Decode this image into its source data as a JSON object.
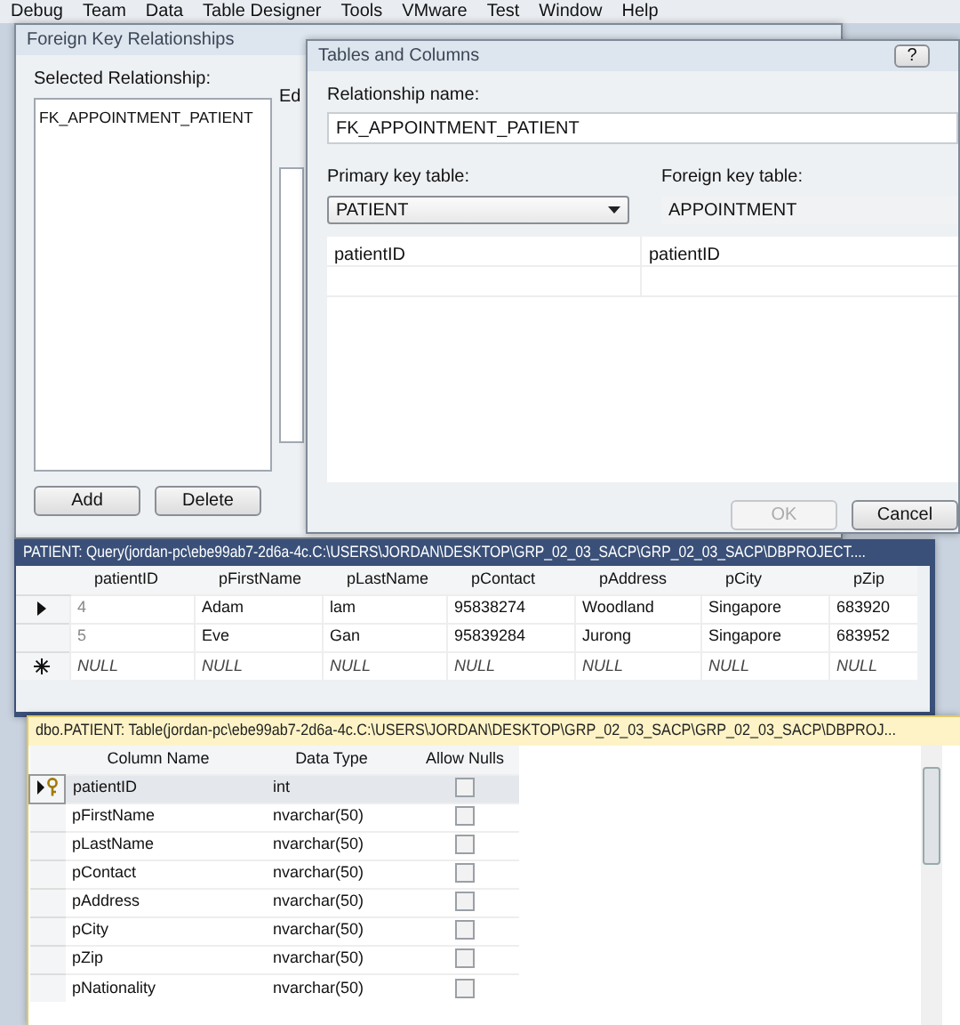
{
  "menu": [
    "Debug",
    "Team",
    "Data",
    "Table Designer",
    "Tools",
    "VMware",
    "Test",
    "Window",
    "Help"
  ],
  "fk_dialog": {
    "title": "Foreign Key Relationships",
    "list_label": "Selected Relationship:",
    "relationships": [
      {
        "name": "FK_APPOINTMENT_PATIENT",
        "selected": false
      }
    ],
    "partial_label": "Ed",
    "buttons": [
      "Add",
      "Delete"
    ]
  },
  "tc_dialog": {
    "title": "Tables and Columns",
    "help": "?",
    "name_label": "Relationship name:",
    "name_value": "FK_APPOINTMENT_PATIENT",
    "pk_label": "Primary key table:",
    "pk_value": "PATIENT",
    "fk_label": "Foreign key table:",
    "fk_value": "APPOINTMENT",
    "mappings": [
      {
        "primary": "patientID",
        "foreign": "patientID"
      }
    ],
    "buttons": [
      {
        "label": "OK",
        "disabled": true
      },
      {
        "label": "Cancel",
        "disabled": false
      }
    ]
  },
  "query": {
    "title": "PATIENT: Query(jordan-pc\\ebe99ab7-2d6a-4c.C:\\USERS\\JORDAN\\DESKTOP\\GRP_02_03_SACP\\GRP_02_03_SACP\\DBPROJECT....",
    "columns": [
      "patientID",
      "pFirstName",
      "pLastName",
      "pContact",
      "pAddress",
      "pCity",
      "pZip"
    ],
    "rows": [
      {
        "kind": "current",
        "cells": [
          "4",
          "Adam",
          "lam",
          "95838274",
          "Woodland",
          "Singapore",
          "683920"
        ]
      },
      {
        "kind": "data",
        "cells": [
          "5",
          "Eve",
          "Gan",
          "95839284",
          "Jurong",
          "Singapore",
          "683952"
        ]
      },
      {
        "kind": "new",
        "cells": [
          "NULL",
          "NULL",
          "NULL",
          "NULL",
          "NULL",
          "NULL",
          "NULL"
        ]
      }
    ]
  },
  "designer": {
    "title": "dbo.PATIENT: Table(jordan-pc\\ebe99ab7-2d6a-4c.C:\\USERS\\JORDAN\\DESKTOP\\GRP_02_03_SACP\\GRP_02_03_SACP\\DBPROJ...",
    "columns": [
      "Column Name",
      "Data Type",
      "Allow Nulls"
    ],
    "rows": [
      {
        "name": "patientID",
        "type": "int",
        "allow_nulls": false,
        "primary_key": true,
        "selected": true
      },
      {
        "name": "pFirstName",
        "type": "nvarchar(50)",
        "allow_nulls": false,
        "primary_key": false,
        "selected": false
      },
      {
        "name": "pLastName",
        "type": "nvarchar(50)",
        "allow_nulls": false,
        "primary_key": false,
        "selected": false
      },
      {
        "name": "pContact",
        "type": "nvarchar(50)",
        "allow_nulls": false,
        "primary_key": false,
        "selected": false
      },
      {
        "name": "pAddress",
        "type": "nvarchar(50)",
        "allow_nulls": false,
        "primary_key": false,
        "selected": false
      },
      {
        "name": "pCity",
        "type": "nvarchar(50)",
        "allow_nulls": false,
        "primary_key": false,
        "selected": false
      },
      {
        "name": "pZip",
        "type": "nvarchar(50)",
        "allow_nulls": false,
        "primary_key": false,
        "selected": false
      },
      {
        "name": "pNationality",
        "type": "nvarchar(50)",
        "allow_nulls": false,
        "primary_key": false,
        "selected": false
      }
    ]
  }
}
